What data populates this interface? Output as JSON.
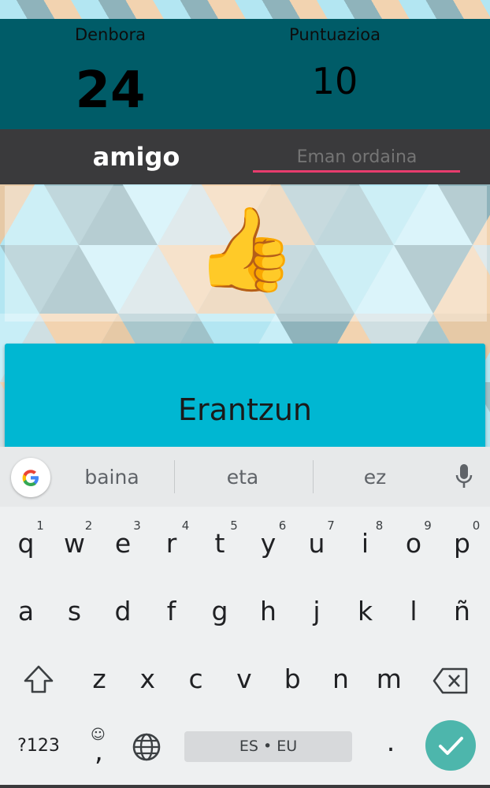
{
  "score_panel": {
    "time_label": "Denbora",
    "time_value": "24",
    "score_label": "Puntuazioa",
    "score_value": "10"
  },
  "word_bar": {
    "word": "amigo",
    "answer_placeholder": "Eman ordaina"
  },
  "feedback": {
    "emoji": "👍"
  },
  "answer_button": {
    "label": "Erantzun"
  },
  "keyboard": {
    "suggestions": [
      "baina",
      "eta",
      "ez"
    ],
    "row1": [
      "q",
      "w",
      "e",
      "r",
      "t",
      "y",
      "u",
      "i",
      "o",
      "p"
    ],
    "row1_hints": [
      "1",
      "2",
      "3",
      "4",
      "5",
      "6",
      "7",
      "8",
      "9",
      "0"
    ],
    "row2": [
      "a",
      "s",
      "d",
      "f",
      "g",
      "h",
      "j",
      "k",
      "l",
      "ñ"
    ],
    "row3": [
      "z",
      "x",
      "c",
      "v",
      "b",
      "n",
      "m"
    ],
    "symbols_key": "?123",
    "comma_key": ",",
    "period_key": ".",
    "space_label": "ES • EU"
  },
  "colors": {
    "panel": "#005c68",
    "word_bar": "#3a3a3c",
    "underline": "#e73c6d",
    "answer_button": "#00b7d2",
    "enter_key": "#4db6ac"
  }
}
